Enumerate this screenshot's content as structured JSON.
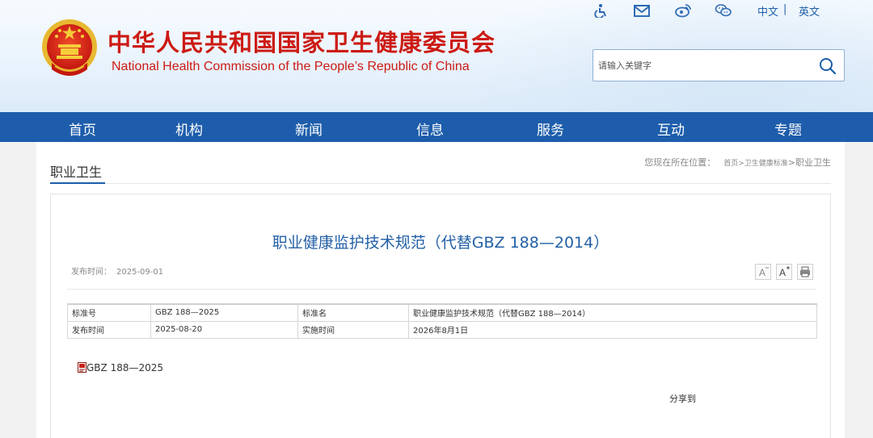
{
  "header": {
    "site_name_cn": "中华人民共和国国家卫生健康委员会",
    "site_name_en": "National Health Commission of the People’s Republic of China",
    "lang_cn": "中文",
    "lang_sep": "|",
    "lang_en": "英文",
    "tool_icons": [
      "accessibility-icon",
      "mail-icon",
      "weibo-icon",
      "wechat-icon"
    ]
  },
  "search": {
    "placeholder": "请输入关键字"
  },
  "nav": {
    "items": [
      "首页",
      "机构",
      "新闻",
      "信息",
      "服务",
      "互动",
      "专题"
    ]
  },
  "section": {
    "title": "职业卫生"
  },
  "breadcrumb": {
    "label": "您现在所在位置：",
    "items": [
      "首页",
      "卫生健康标准"
    ],
    "separator": ">",
    "current": "职业卫生"
  },
  "article": {
    "title": "职业健康监护技术规范（代替GBZ 188—2014）",
    "publish_label": "发布时间：",
    "publish_date": "2025-09-01",
    "font_tools": [
      "A-",
      "A+",
      "print-icon"
    ],
    "table": [
      [
        {
          "label": "标准号",
          "value": "GBZ 188—2025"
        },
        {
          "label": "标准名",
          "value": "职业健康监护技术规范（代替GBZ 188—2014）"
        }
      ],
      [
        {
          "label": "发布时间",
          "value": "2025-08-20"
        },
        {
          "label": "实施时间",
          "value": "2026年8月1日"
        }
      ]
    ],
    "attachment": "GBZ 188—2025",
    "share_label": "分享到"
  },
  "colors": {
    "brand_red": "#cc1b14",
    "nav_blue": "#1d5dab",
    "title_blue": "#2360a6"
  }
}
